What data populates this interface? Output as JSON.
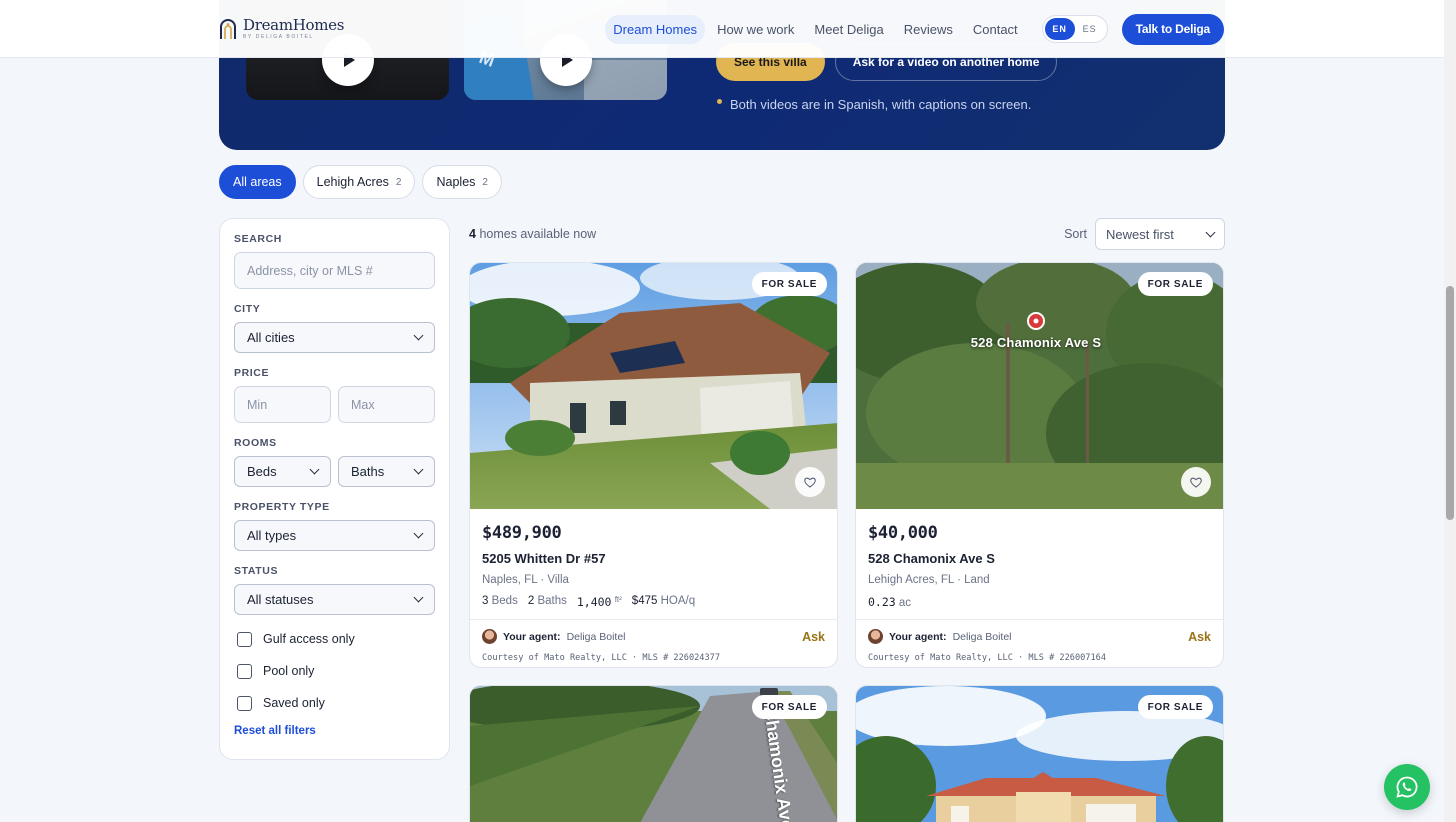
{
  "header": {
    "logo_title": "DreamHomes",
    "logo_sub": "BY DELIGA BOITEL",
    "nav": [
      "Dream Homes",
      "How we work",
      "Meet Deliga",
      "Reviews",
      "Contact"
    ],
    "lang_en": "EN",
    "lang_es": "ES",
    "cta": "Talk to Deliga"
  },
  "hero": {
    "btn_villa": "See this villa",
    "btn_ask_video": "Ask for a video on another home",
    "note": "Both videos are in Spanish, with captions on screen."
  },
  "areas": [
    {
      "label": "All areas",
      "count": ""
    },
    {
      "label": "Lehigh Acres",
      "count": "2"
    },
    {
      "label": "Naples",
      "count": "2"
    }
  ],
  "filters": {
    "search_label": "SEARCH",
    "search_placeholder": "Address, city or MLS #",
    "city_label": "CITY",
    "city_value": "All cities",
    "price_label": "PRICE",
    "price_min": "Min",
    "price_max": "Max",
    "rooms_label": "ROOMS",
    "beds": "Beds",
    "baths": "Baths",
    "type_label": "PROPERTY TYPE",
    "type_value": "All types",
    "status_label": "STATUS",
    "status_value": "All statuses",
    "gulf": "Gulf access only",
    "pool": "Pool only",
    "saved": "Saved only",
    "reset": "Reset all filters"
  },
  "results": {
    "count": "4",
    "count_text": "homes available now",
    "sort_label": "Sort",
    "sort_value": "Newest first"
  },
  "listings": [
    {
      "badge": "FOR SALE",
      "price": "$489,900",
      "address": "5205 Whitten Dr #57",
      "sub": "Naples, FL · Villa",
      "beds": "3",
      "beds_label": "Beds",
      "baths": "2",
      "baths_label": "Baths",
      "sqft": "1,400",
      "sqft_unit": "ft²",
      "hoa": "$475",
      "hoa_unit": "HOA/q",
      "agent_label": "Your agent:",
      "agent_name": "Deliga Boitel",
      "ask": "Ask",
      "courtesy": "Courtesy of Mato Realty, LLC · MLS # 226024377"
    },
    {
      "badge": "FOR SALE",
      "price": "$40,000",
      "address": "528 Chamonix Ave S",
      "sub": "Lehigh Acres, FL · Land",
      "acres": "0.23",
      "acres_unit": "ac",
      "map_label": "528 Chamonix Ave S",
      "agent_label": "Your agent:",
      "agent_name": "Deliga Boitel",
      "ask": "Ask",
      "courtesy": "Courtesy of Mato Realty, LLC · MLS # 226007164"
    },
    {
      "badge": "FOR SALE",
      "road_label": "Chamonix Ave S"
    },
    {
      "badge": "FOR SALE"
    }
  ]
}
